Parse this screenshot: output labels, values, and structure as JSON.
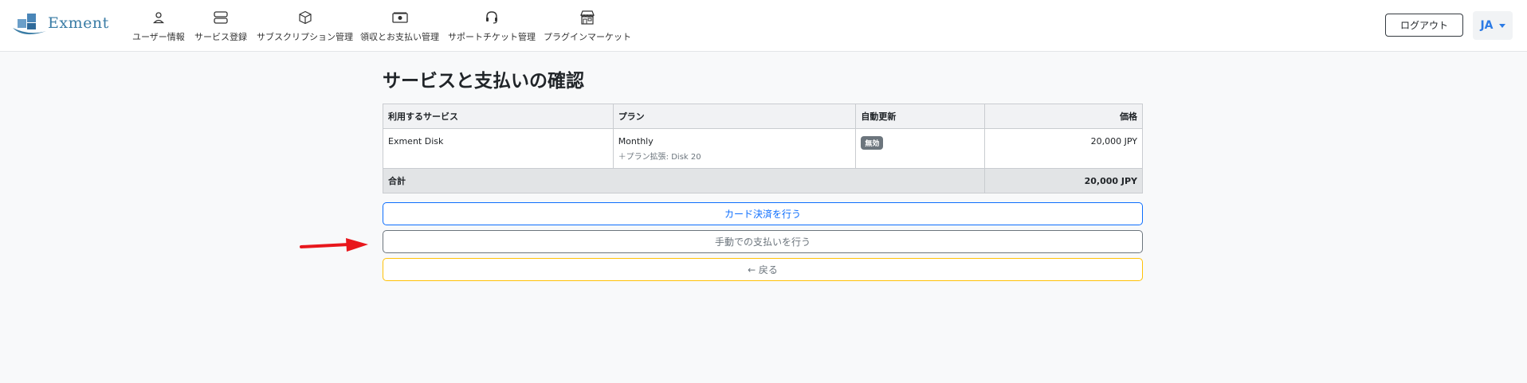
{
  "brand": {
    "name": "Exment"
  },
  "nav": [
    {
      "label": "ユーザー情報",
      "icon": "user-icon"
    },
    {
      "label": "サービス登録",
      "icon": "server-icon"
    },
    {
      "label": "サブスクリプション管理",
      "icon": "box-icon"
    },
    {
      "label": "領収とお支払い管理",
      "icon": "cash-icon"
    },
    {
      "label": "サポートチケット管理",
      "icon": "headset-icon"
    },
    {
      "label": "プラグインマーケット",
      "icon": "shop-icon"
    }
  ],
  "header": {
    "logout_label": "ログアウト",
    "lang_label": "JA"
  },
  "page": {
    "title": "サービスと支払いの確認"
  },
  "table": {
    "headers": {
      "service": "利用するサービス",
      "plan": "プラン",
      "auto_renew": "自動更新",
      "price": "価格"
    },
    "rows": [
      {
        "service": "Exment Disk",
        "plan": "Monthly",
        "plan_sub": "＋プラン拡張: Disk 20",
        "auto_renew": "無効",
        "price": "20,000 JPY"
      }
    ],
    "total": {
      "label": "合計",
      "value": "20,000 JPY"
    }
  },
  "actions": {
    "card_label": "カード決済を行う",
    "manual_label": "手動での支払いを行う",
    "back_label": "← 戻る"
  },
  "colors": {
    "primary": "#0d6efd",
    "secondary": "#6c757d",
    "warning": "#ffc107",
    "brand": "#3a7ca5",
    "arrow": "#e8171c"
  }
}
